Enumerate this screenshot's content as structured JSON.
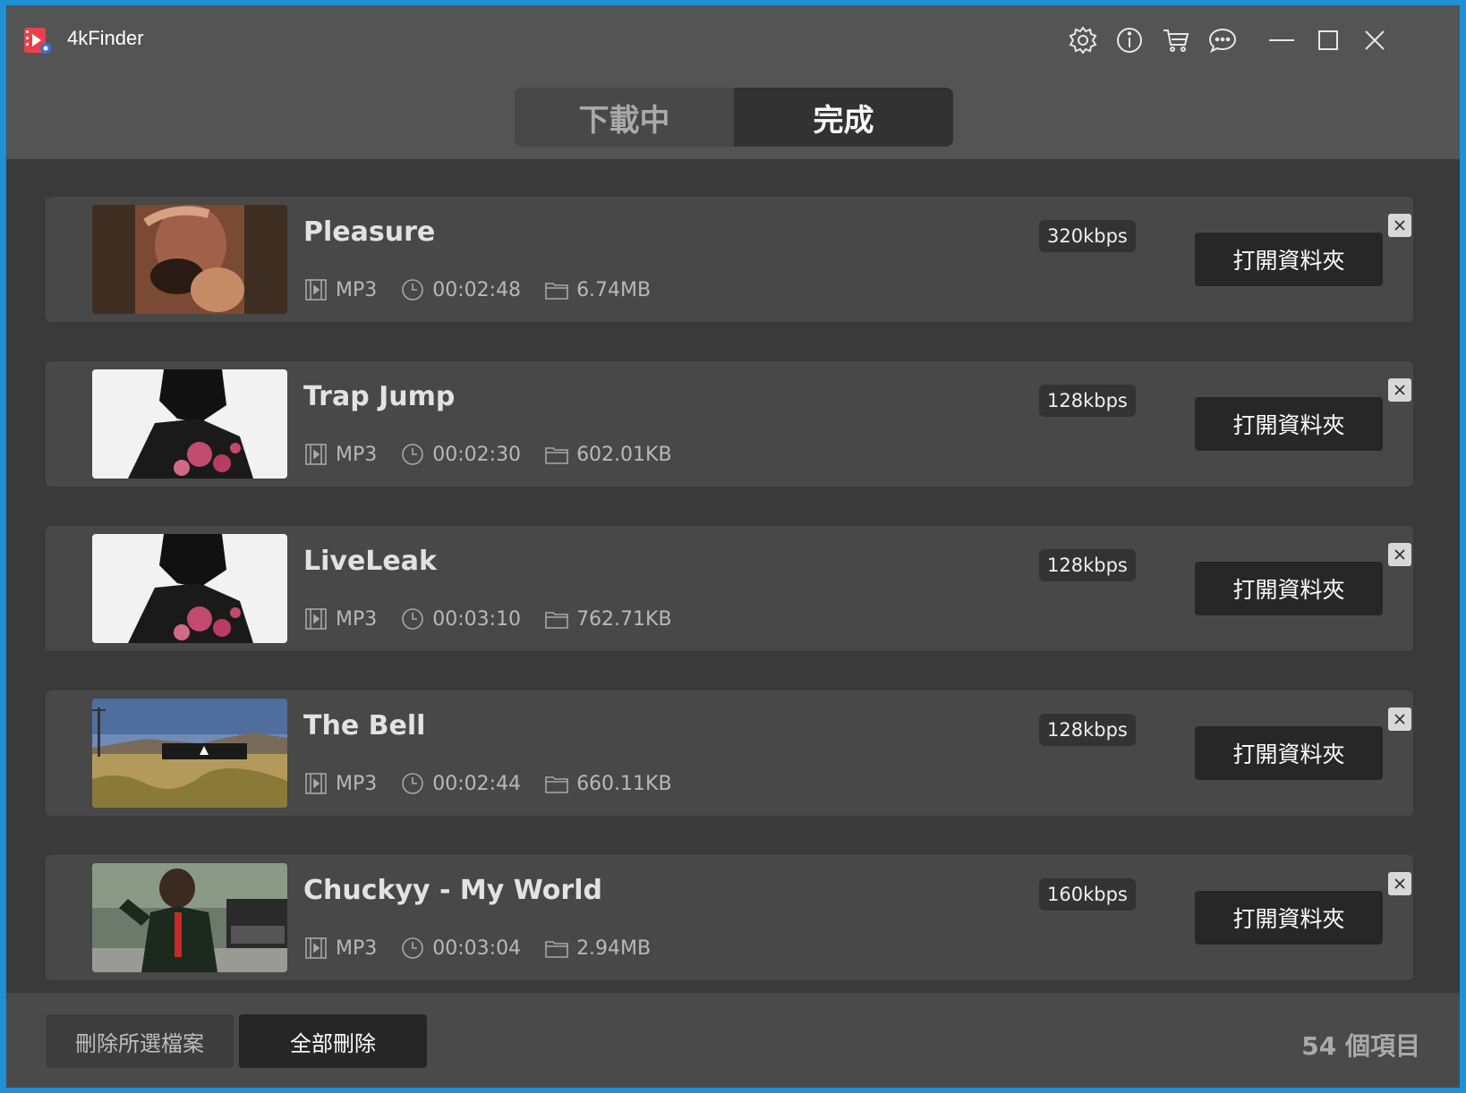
{
  "app": {
    "title": "4kFinder"
  },
  "titlebar": {
    "icons": [
      "gear-icon",
      "info-icon",
      "cart-icon",
      "chat-icon",
      "minimize-icon",
      "maximize-icon",
      "close-icon"
    ]
  },
  "tabs": [
    {
      "label": "下載中",
      "active": false
    },
    {
      "label": "完成",
      "active": true
    }
  ],
  "items": [
    {
      "title": "Pleasure",
      "format": "MP3",
      "duration": "00:02:48",
      "size": "6.74MB",
      "bitrate": "320kbps",
      "open_label": "打開資料夾"
    },
    {
      "title": "Trap Jump",
      "format": "MP3",
      "duration": "00:02:30",
      "size": "602.01KB",
      "bitrate": "128kbps",
      "open_label": "打開資料夾"
    },
    {
      "title": "LiveLeak",
      "format": "MP3",
      "duration": "00:03:10",
      "size": "762.71KB",
      "bitrate": "128kbps",
      "open_label": "打開資料夾"
    },
    {
      "title": "The Bell",
      "format": "MP3",
      "duration": "00:02:44",
      "size": "660.11KB",
      "bitrate": "128kbps",
      "open_label": "打開資料夾"
    },
    {
      "title": "Chuckyy - My World",
      "format": "MP3",
      "duration": "00:03:04",
      "size": "2.94MB",
      "bitrate": "160kbps",
      "open_label": "打開資料夾"
    }
  ],
  "footer": {
    "delete_selected": "刪除所選檔案",
    "delete_all": "全部刪除",
    "count": "54 個項目"
  },
  "colors": {
    "window_bg": "#3a3a3a",
    "titlebar_bg": "#545454",
    "item_bg": "#484848",
    "button_dark": "#272727",
    "logo_red": "#e8414b"
  }
}
